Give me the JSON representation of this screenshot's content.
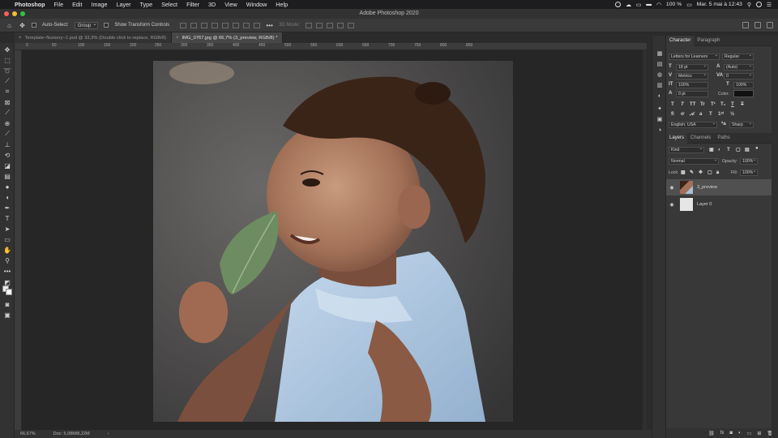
{
  "menubar": {
    "app": "Photoshop",
    "items": [
      "File",
      "Edit",
      "Image",
      "Layer",
      "Type",
      "Select",
      "Filter",
      "3D",
      "View",
      "Window",
      "Help"
    ],
    "battery": "100 %",
    "datetime": "Mar. 5 mai à 12:43"
  },
  "window": {
    "title": "Adobe Photoshop 2020",
    "lights": [
      "#ff5f57",
      "#febc2e",
      "#28c840"
    ]
  },
  "options": {
    "auto_select_label": "Auto-Select:",
    "auto_select_value": "Group",
    "transform_label": "Show Transform Controls",
    "mode_3d": "3D Mode:"
  },
  "tabs": [
    {
      "label": "Template–Nursery–1.psd @ 33,3% (Double click to replace, RGB/8)",
      "active": false
    },
    {
      "label": "IMG_0767.jpg @ 66,7% (3_preview, RGB/8) *",
      "active": true
    }
  ],
  "ruler": {
    "top_labels": [
      "0",
      "50",
      "100",
      "150",
      "200",
      "250",
      "300",
      "350",
      "400",
      "450",
      "500",
      "550",
      "600",
      "650",
      "700",
      "750",
      "800",
      "850"
    ]
  },
  "status": {
    "zoom": "66,67%",
    "doc": "Doc: 5,08M/8,22M"
  },
  "character": {
    "tab_character": "Character",
    "tab_paragraph": "Paragraph",
    "font_family": "Letters for Learners",
    "font_style": "Regular",
    "font_size": "18 pt",
    "leading": "(Auto)",
    "kerning": "Metrics",
    "tracking": "0",
    "vertical_scale": "100%",
    "horizontal_scale": "100%",
    "baseline_shift": "0 pt",
    "color_label": "Color:",
    "language": "English: USA",
    "antialias": "Sharp",
    "style_buttons": [
      "T",
      "T",
      "TT",
      "Tr",
      "T¹",
      "T₁",
      "T",
      "T"
    ]
  },
  "layers": {
    "tab_layers": "Layers",
    "tab_channels": "Channels",
    "tab_paths": "Paths",
    "kind": "Kind",
    "blend_mode": "Normal",
    "opacity_label": "Opacity:",
    "opacity": "100%",
    "lock_label": "Lock:",
    "fill_label": "Fill:",
    "fill": "100%",
    "items": [
      {
        "name": "3_preview",
        "active": true
      },
      {
        "name": "Layer 0",
        "active": false
      }
    ]
  }
}
